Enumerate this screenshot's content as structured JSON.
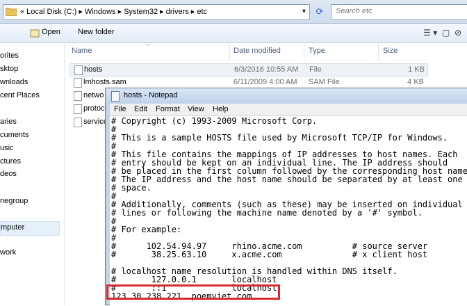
{
  "address": {
    "path": "«  Local Disk (C:)  ▸  Windows  ▸  System32  ▸  drivers  ▸  etc"
  },
  "search": {
    "placeholder": "Search etc"
  },
  "toolbar": {
    "open_label": "Open",
    "new_folder_label": "New folder"
  },
  "nav": {
    "items": [
      "orites",
      "sktop",
      "wnloads",
      "cent Places",
      "aries",
      "cuments",
      "usic",
      "ctures",
      "deos",
      "negroup",
      "mputer",
      "work"
    ]
  },
  "columns": {
    "name": "Name",
    "date": "Date modified",
    "type": "Type",
    "size": "Size"
  },
  "files": [
    {
      "name": "hosts",
      "date": "6/3/2016 10:55 AM",
      "type": "File",
      "size": "1 KB"
    },
    {
      "name": "lmhosts.sam",
      "date": "6/11/2009 4:00 AM",
      "type": "SAM File",
      "size": "4 KB"
    },
    {
      "name": "netwo",
      "date": "",
      "type": "",
      "size": ""
    },
    {
      "name": "protoc",
      "date": "",
      "type": "",
      "size": ""
    },
    {
      "name": "service",
      "date": "",
      "type": "",
      "size": ""
    }
  ],
  "notepad": {
    "title": "hosts - Notepad",
    "menu": [
      "File",
      "Edit",
      "Format",
      "View",
      "Help"
    ],
    "lines": [
      "# Copyright (c) 1993-2009 Microsoft Corp.",
      "#",
      "# This is a sample HOSTS file used by Microsoft TCP/IP for Windows.",
      "#",
      "# This file contains the mappings of IP addresses to host names. Each",
      "# entry should be kept on an individual line. The IP address should",
      "# be placed in the first column followed by the corresponding host name",
      "# The IP address and the host name should be separated by at least one",
      "# space.",
      "#",
      "# Additionally, comments (such as these) may be inserted on individual",
      "# lines or following the machine name denoted by a '#' symbol.",
      "#",
      "# For example:",
      "#",
      "#      102.54.94.97     rhino.acme.com          # source server",
      "#       38.25.63.10     x.acme.com              # x client host",
      "",
      "# localhost name resolution is handled within DNS itself.",
      "#       127.0.0.1       localhost",
      "#       ::1             localhost",
      "123.30.238.221  poemviet.com"
    ]
  },
  "colors": {
    "highlight": "#d72b2b"
  }
}
